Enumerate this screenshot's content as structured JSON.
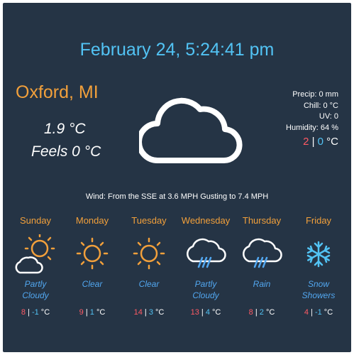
{
  "datetime": "February 24, 5:24:41 pm",
  "location": "Oxford, MI",
  "current": {
    "temp": "1.9 °C",
    "feels": "Feels 0 °C",
    "icon": "cloud-icon"
  },
  "stats": {
    "precip": "Precip: 0 mm",
    "chill": "Chill: 0 °C",
    "uv": "UV: 0",
    "humidity": "Humidity: 64 %"
  },
  "today_hilo": {
    "hi": "2",
    "sep": " | ",
    "lo": "0",
    "unit": " °C"
  },
  "wind": "Wind: From the SSE at 3.6 MPH Gusting to 7.4 MPH",
  "forecast": [
    {
      "day": "Sunday",
      "desc1": "Partly",
      "desc2": "Cloudy",
      "icon": "partly-cloudy-icon",
      "hi": "8",
      "lo": "-1",
      "unit": " °C"
    },
    {
      "day": "Monday",
      "desc1": "Clear",
      "desc2": "",
      "icon": "sun-icon",
      "hi": "9",
      "lo": "1",
      "unit": " °C"
    },
    {
      "day": "Tuesday",
      "desc1": "Clear",
      "desc2": "",
      "icon": "sun-icon",
      "hi": "14",
      "lo": "3",
      "unit": " °C"
    },
    {
      "day": "Wednesday",
      "desc1": "Partly",
      "desc2": "Cloudy",
      "icon": "rain-cloud-icon",
      "hi": "13",
      "lo": "4",
      "unit": " °C"
    },
    {
      "day": "Thursday",
      "desc1": "Rain",
      "desc2": "",
      "icon": "rain-cloud-icon",
      "hi": "8",
      "lo": "2",
      "unit": " °C"
    },
    {
      "day": "Friday",
      "desc1": "Snow",
      "desc2": "Showers",
      "icon": "snowflake-icon",
      "hi": "4",
      "lo": "-1",
      "unit": " °C"
    }
  ],
  "separator": " | ",
  "colors": {
    "background": "#253445",
    "accent_orange": "#f2a03b",
    "accent_blue": "#52c3f4",
    "high": "#ff5a65"
  }
}
